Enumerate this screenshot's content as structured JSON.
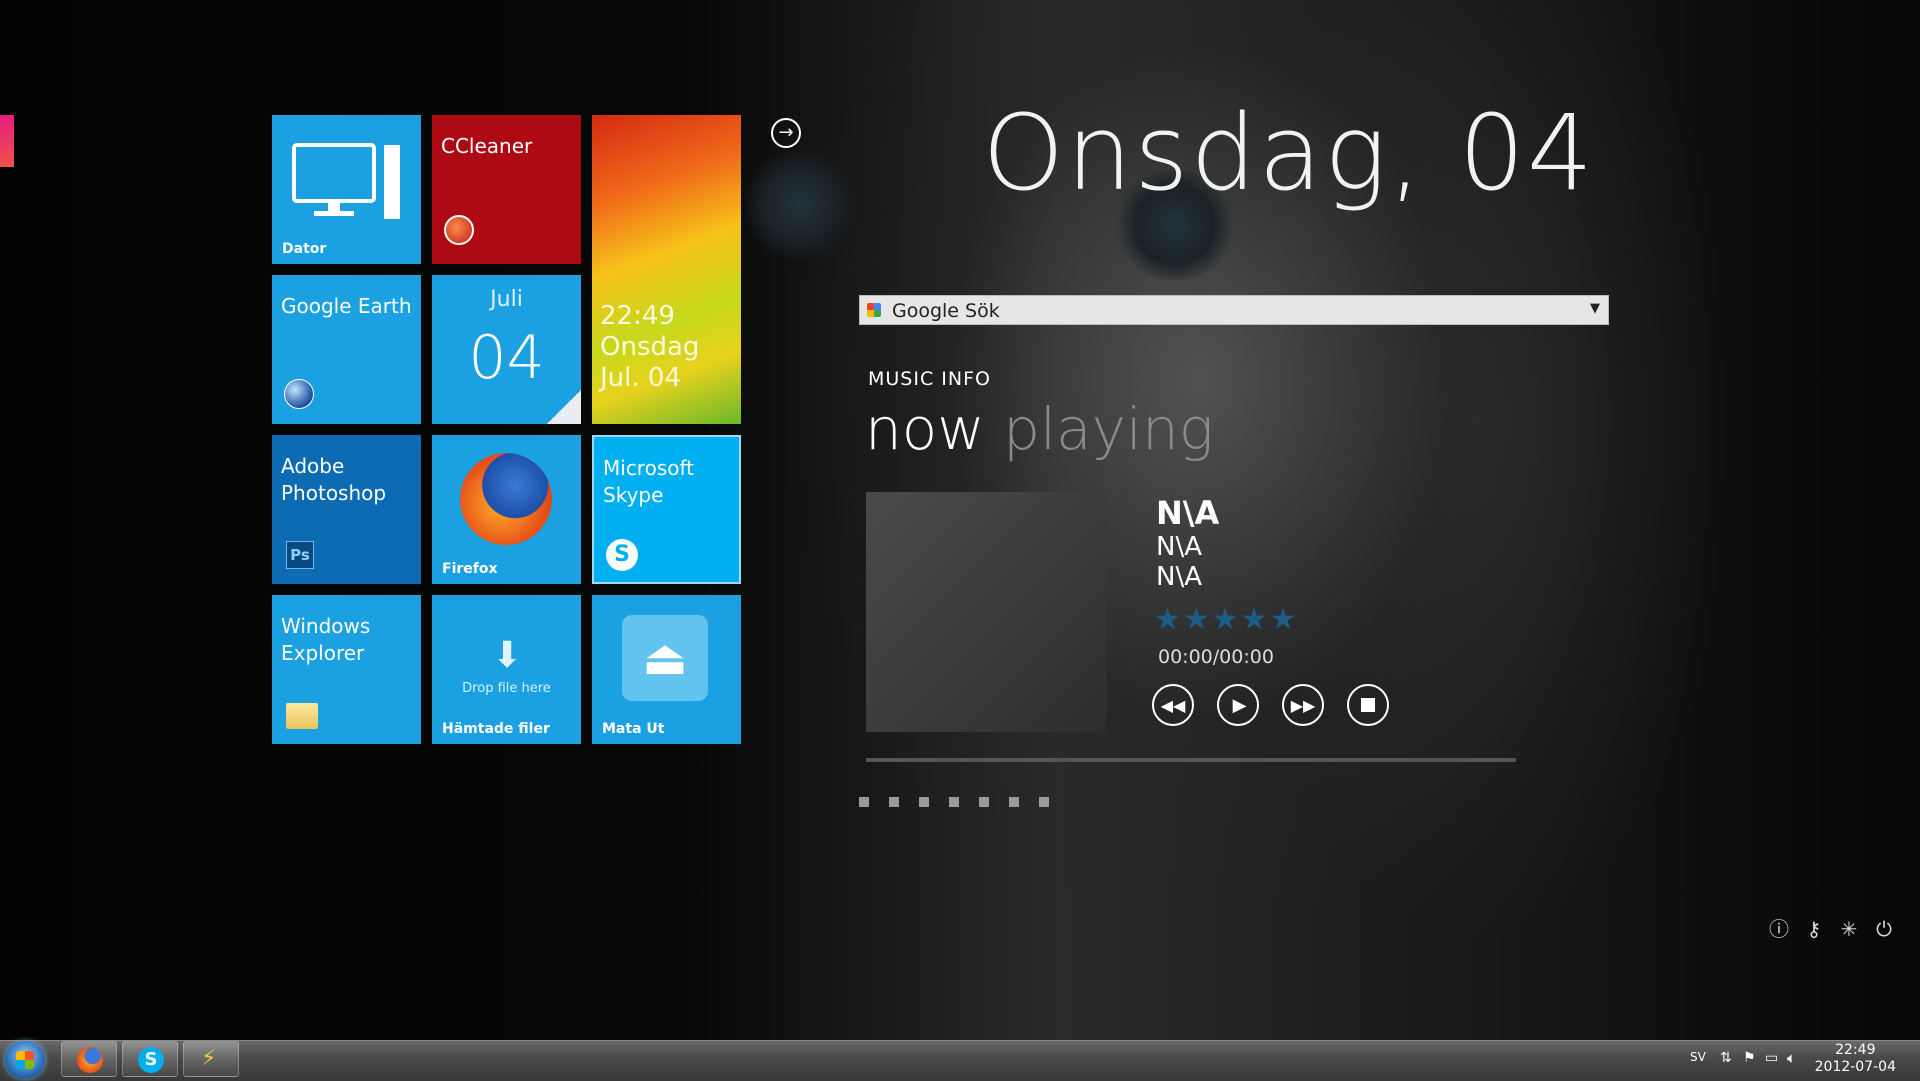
{
  "tiles": {
    "dator": {
      "caption": "Dator"
    },
    "ccleaner": {
      "title": "CCleaner"
    },
    "clock_tile": {
      "time": "22:49",
      "day": "Onsdag",
      "date": "Jul. 04"
    },
    "google_earth": {
      "title": "Google Earth"
    },
    "calendar": {
      "month": "Juli",
      "day": "04"
    },
    "photoshop": {
      "title_line1": "Adobe",
      "title_line2": "Photoshop",
      "icon_text": "Ps"
    },
    "firefox": {
      "caption": "Firefox"
    },
    "skype": {
      "title_line1": "Microsoft",
      "title_line2": "Skype",
      "icon_text": "S"
    },
    "explorer": {
      "title_line1": "Windows",
      "title_line2": "Explorer"
    },
    "downloads": {
      "drop_text": "Drop file here",
      "caption": "Hämtade filer"
    },
    "eject": {
      "caption": "Mata Ut"
    }
  },
  "header": {
    "date_big": "Onsdag, 04"
  },
  "search": {
    "label": "Google Sök"
  },
  "music": {
    "section_label": "MUSIC INFO",
    "now": "now",
    "playing": "playing",
    "title": "N\\A",
    "artist": "N\\A",
    "album": "N\\A",
    "rating": 0,
    "stars": "★★★★★",
    "time": "00:00/00:00",
    "progress": 0
  },
  "pager": {
    "pages": 7
  },
  "taskbar": {
    "language": "SV",
    "time": "22:49",
    "date": "2012-07-04"
  },
  "colors": {
    "tile_blue": "#1ba1e2",
    "tile_dark_blue": "#0c6bb3",
    "tile_red": "#ad0a14",
    "accent": "#e81c7f"
  }
}
